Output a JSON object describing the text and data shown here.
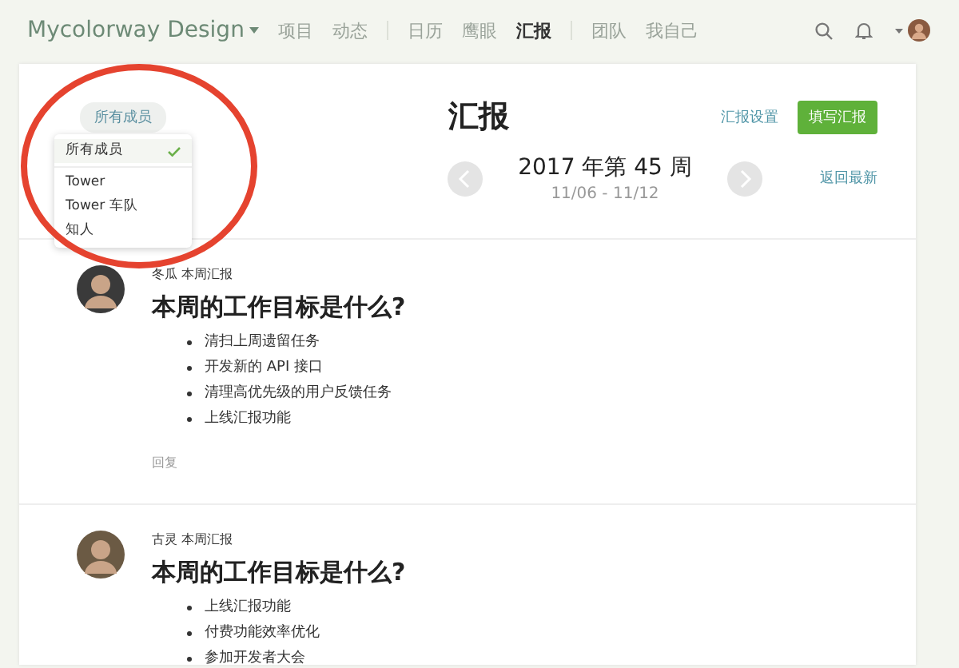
{
  "nav": {
    "brand": "Mycolorway Design",
    "groups": [
      [
        {
          "label": "项目",
          "selected": false
        },
        {
          "label": "动态",
          "selected": false
        }
      ],
      [
        {
          "label": "日历",
          "selected": false
        },
        {
          "label": "鹰眼",
          "selected": false
        },
        {
          "label": "汇报",
          "selected": true
        }
      ],
      [
        {
          "label": "团队",
          "selected": false
        },
        {
          "label": "我自己",
          "selected": false
        }
      ]
    ]
  },
  "header": {
    "member_filter": "所有成员",
    "title": "汇报",
    "settings_link": "汇报设置",
    "write_button": "填写汇报"
  },
  "week": {
    "title": "2017 年第 45 周",
    "range": "11/06 - 11/12",
    "latest_link": "返回最新"
  },
  "dropdown": {
    "items": [
      {
        "label": "所有成员",
        "selected": true
      },
      {
        "label": "Tower",
        "selected": false
      },
      {
        "label": "Tower 车队",
        "selected": false
      },
      {
        "label": "知人",
        "selected": false
      }
    ]
  },
  "reports": [
    {
      "author": "冬瓜 本周汇报",
      "question": "本周的工作目标是什么?",
      "items": [
        "清扫上周遗留任务",
        "开发新的 API 接口",
        "清理高优先级的用户反馈任务",
        "上线汇报功能"
      ],
      "reply": "回复"
    },
    {
      "author": "古灵 本周汇报",
      "question": "本周的工作目标是什么?",
      "items": [
        "上线汇报功能",
        "付费功能效率优化",
        "参加开发者大会"
      ]
    }
  ]
}
